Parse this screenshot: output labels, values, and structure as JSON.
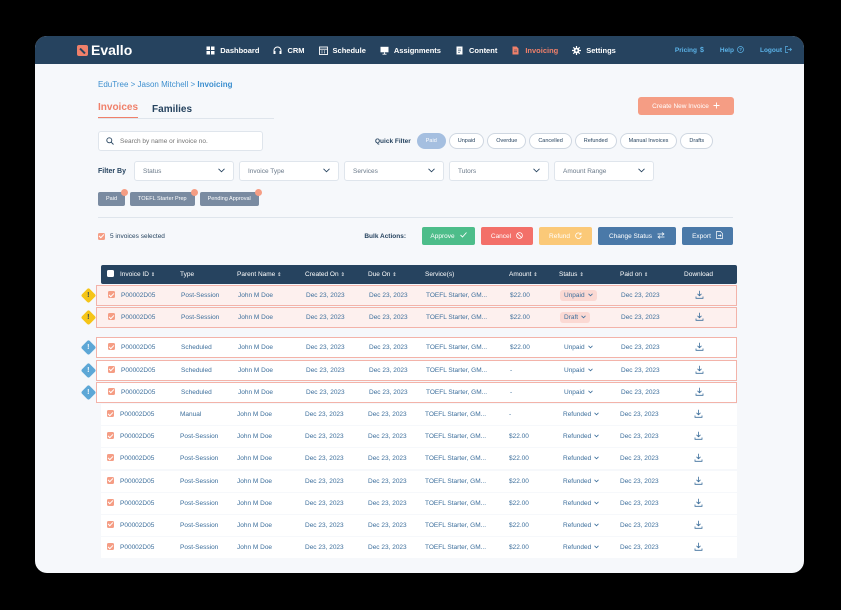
{
  "nav": {
    "logo": "Evallo",
    "items": [
      {
        "label": "Dashboard",
        "icon": "grid-icon",
        "active": false
      },
      {
        "label": "CRM",
        "icon": "headset-icon",
        "active": false
      },
      {
        "label": "Schedule",
        "icon": "calendar-icon",
        "active": false
      },
      {
        "label": "Assignments",
        "icon": "monitor-icon",
        "active": false
      },
      {
        "label": "Content",
        "icon": "document-icon",
        "active": false
      },
      {
        "label": "Invoicing",
        "icon": "invoice-icon",
        "active": true
      },
      {
        "label": "Settings",
        "icon": "gear-icon",
        "active": false
      }
    ],
    "right": [
      {
        "label": "Pricing",
        "icon": "dollar-icon"
      },
      {
        "label": "Help",
        "icon": "help-icon"
      },
      {
        "label": "Logout",
        "icon": "logout-icon"
      }
    ]
  },
  "breadcrumb": {
    "part1": "EduTree",
    "sep1": ">",
    "part2": "Jason Mitchell",
    "sep2": ">",
    "current": "Invoicing"
  },
  "tabs": [
    {
      "label": "Invoices",
      "active": true
    },
    {
      "label": "Families",
      "active": false
    }
  ],
  "create_button": "Create New Invoice",
  "search": {
    "placeholder": "Search by name or invoice no."
  },
  "quick_filter": {
    "label": "Quick Filter",
    "chips": [
      {
        "label": "Paid",
        "active": true
      },
      {
        "label": "Unpaid",
        "active": false
      },
      {
        "label": "Overdue",
        "active": false
      },
      {
        "label": "Cancelled",
        "active": false
      },
      {
        "label": "Refunded",
        "active": false
      },
      {
        "label": "Manual Invoices",
        "active": false
      },
      {
        "label": "Drafts",
        "active": false
      }
    ]
  },
  "filter_by": {
    "label": "Filter By",
    "selects": [
      "Status",
      "Invoice Type",
      "Services",
      "Tutors",
      "Amount Range"
    ]
  },
  "active_tags": [
    "Paid",
    "TOEFL Starter Prep",
    "Pending Approval"
  ],
  "bulk": {
    "selected_text": "5 invoices selected",
    "label": "Bulk Actions:",
    "approve": "Approve",
    "cancel": "Cancel",
    "refund": "Refund",
    "change_status": "Change Status",
    "export": "Export"
  },
  "table": {
    "columns": [
      "Invoice ID",
      "Type",
      "Parent Name",
      "Created On",
      "Due On",
      "Service(s)",
      "Amount",
      "Status",
      "Paid on",
      "Download"
    ],
    "rows": [
      {
        "id": "P00002D05",
        "type": "Post-Session",
        "parent": "John M Doe",
        "created": "Dec 23, 2023",
        "due": "Dec 23, 2023",
        "service": "TOEFL Starter, GM...",
        "amount": "$22.00",
        "status": "Unpaid",
        "paid_on": "Dec 23, 2023",
        "flag": "warn"
      },
      {
        "id": "P00002D05",
        "type": "Post-Session",
        "parent": "John M Doe",
        "created": "Dec 23, 2023",
        "due": "Dec 23, 2023",
        "service": "TOEFL Starter, GM...",
        "amount": "$22.00",
        "status": "Draft",
        "paid_on": "Dec 23, 2023",
        "flag": "warn"
      },
      {
        "id": "P00002D05",
        "type": "Scheduled",
        "parent": "John M Doe",
        "created": "Dec 23, 2023",
        "due": "Dec 23, 2023",
        "service": "TOEFL Starter, GM...",
        "amount": "$22.00",
        "status": "Unpaid",
        "paid_on": "Dec 23, 2023",
        "flag": "info"
      },
      {
        "id": "P00002D05",
        "type": "Scheduled",
        "parent": "John M Doe",
        "created": "Dec 23, 2023",
        "due": "Dec 23, 2023",
        "service": "TOEFL Starter, GM...",
        "amount": "-",
        "status": "Unpaid",
        "paid_on": "Dec 23, 2023",
        "flag": "info"
      },
      {
        "id": "P00002D05",
        "type": "Scheduled",
        "parent": "John M Doe",
        "created": "Dec 23, 2023",
        "due": "Dec 23, 2023",
        "service": "TOEFL Starter, GM...",
        "amount": "-",
        "status": "Unpaid",
        "paid_on": "Dec 23, 2023",
        "flag": "info"
      },
      {
        "id": "P00002D05",
        "type": "Manual",
        "parent": "John M Doe",
        "created": "Dec 23, 2023",
        "due": "Dec 23, 2023",
        "service": "TOEFL Starter, GM...",
        "amount": "-",
        "status": "Refunded",
        "paid_on": "Dec 23, 2023",
        "flag": ""
      },
      {
        "id": "P00002D05",
        "type": "Post-Session",
        "parent": "John M Doe",
        "created": "Dec 23, 2023",
        "due": "Dec 23, 2023",
        "service": "TOEFL Starter, GM...",
        "amount": "$22.00",
        "status": "Refunded",
        "paid_on": "Dec 23, 2023",
        "flag": ""
      },
      {
        "id": "P00002D05",
        "type": "Post-Session",
        "parent": "John M Doe",
        "created": "Dec 23, 2023",
        "due": "Dec 23, 2023",
        "service": "TOEFL Starter, GM...",
        "amount": "$22.00",
        "status": "Refunded",
        "paid_on": "Dec 23, 2023",
        "flag": ""
      },
      {
        "id": "P00002D05",
        "type": "Post-Session",
        "parent": "John M Doe",
        "created": "Dec 23, 2023",
        "due": "Dec 23, 2023",
        "service": "TOEFL Starter, GM...",
        "amount": "$22.00",
        "status": "Refunded",
        "paid_on": "Dec 23, 2023",
        "flag": ""
      },
      {
        "id": "P00002D05",
        "type": "Post-Session",
        "parent": "John M Doe",
        "created": "Dec 23, 2023",
        "due": "Dec 23, 2023",
        "service": "TOEFL Starter, GM...",
        "amount": "$22.00",
        "status": "Refunded",
        "paid_on": "Dec 23, 2023",
        "flag": ""
      },
      {
        "id": "P00002D05",
        "type": "Post-Session",
        "parent": "John M Doe",
        "created": "Dec 23, 2023",
        "due": "Dec 23, 2023",
        "service": "TOEFL Starter, GM...",
        "amount": "$22.00",
        "status": "Refunded",
        "paid_on": "Dec 23, 2023",
        "flag": ""
      },
      {
        "id": "P00002D05",
        "type": "Post-Session",
        "parent": "John M Doe",
        "created": "Dec 23, 2023",
        "due": "Dec 23, 2023",
        "service": "TOEFL Starter, GM...",
        "amount": "$22.00",
        "status": "Refunded",
        "paid_on": "Dec 23, 2023",
        "flag": ""
      }
    ]
  },
  "colors": {
    "navy": "#26435f",
    "accent": "#f0806a",
    "link": "#3d8fcf",
    "approve": "#4dbd8a",
    "cancel": "#f37069",
    "refund": "#fbc978",
    "action": "#4a79a8"
  }
}
